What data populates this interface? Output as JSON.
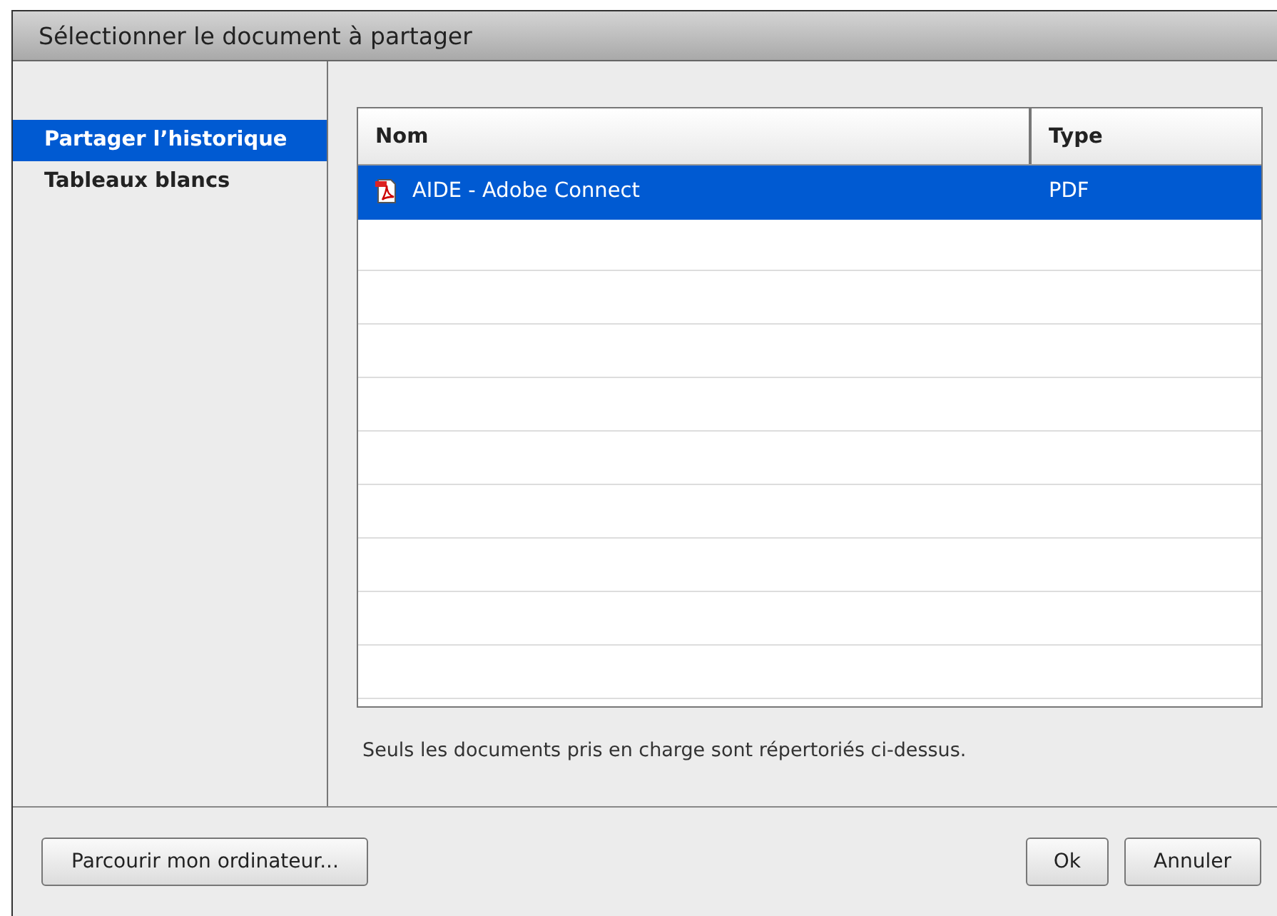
{
  "window": {
    "title": "Sélectionner le document à partager"
  },
  "sidebar": {
    "items": [
      {
        "label": "Partager l’historique",
        "selected": true
      },
      {
        "label": "Tableaux blancs",
        "selected": false
      }
    ]
  },
  "table": {
    "columns": [
      "Nom",
      "Type"
    ],
    "rows": [
      {
        "name": "AIDE - Adobe Connect",
        "type": "PDF",
        "selected": true
      }
    ]
  },
  "note": "Seuls les documents pris en charge sont répertoriés ci-dessus.",
  "buttons": {
    "browse": "Parcourir mon ordinateur...",
    "ok": "Ok",
    "cancel": "Annuler"
  }
}
